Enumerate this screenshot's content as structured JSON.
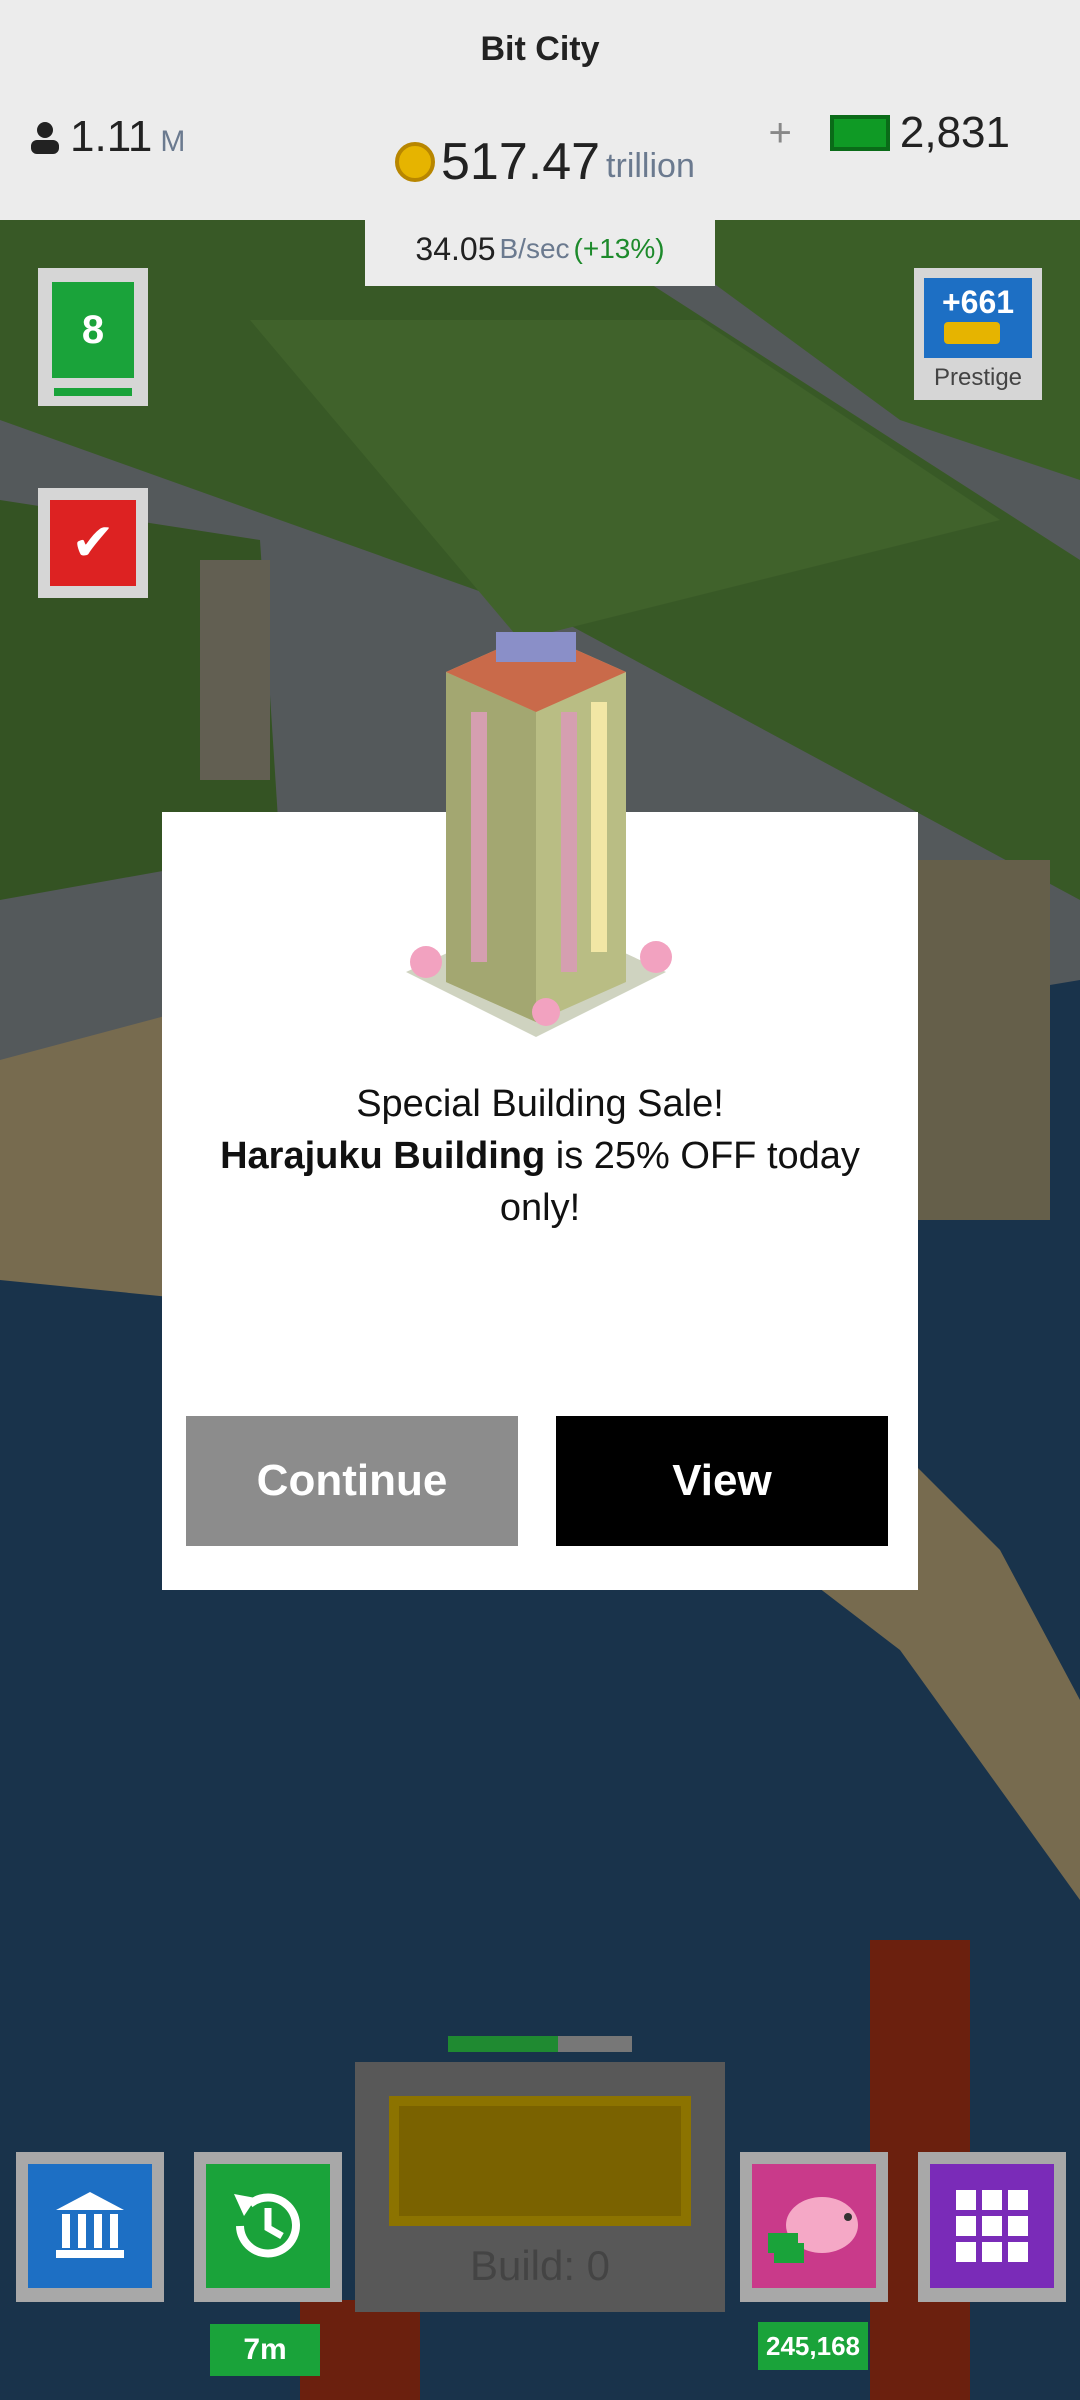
{
  "header": {
    "title": "Bit City",
    "population": "1.11",
    "population_suffix": "M",
    "money": "517.47",
    "money_unit": "trillion",
    "rate": "34.05",
    "rate_unit": "B/sec",
    "rate_bonus": "(+13%)",
    "cash_plus": "+",
    "cash": "2,831"
  },
  "side": {
    "level": "8",
    "check_icon": "checkmark-icon",
    "prestige_value": "+661",
    "prestige_label": "Prestige"
  },
  "dialog": {
    "line1": "Special Building Sale!",
    "building": "Harajuku Building",
    "line2_rest": " is 25% OFF today only!",
    "continue": "Continue",
    "view": "View"
  },
  "bottom": {
    "bank_icon": "bank-icon",
    "timer_badge": "7m",
    "build_label": "Build: 0",
    "build_progress": 0.6,
    "piggy_badge": "245,168",
    "grid_icon": "grid-icon"
  },
  "colors": {
    "accent_green": "#1aa33a",
    "alert_red": "#dd2222",
    "prestige_blue": "#1d6fc4",
    "build_gold": "#e6b400"
  }
}
